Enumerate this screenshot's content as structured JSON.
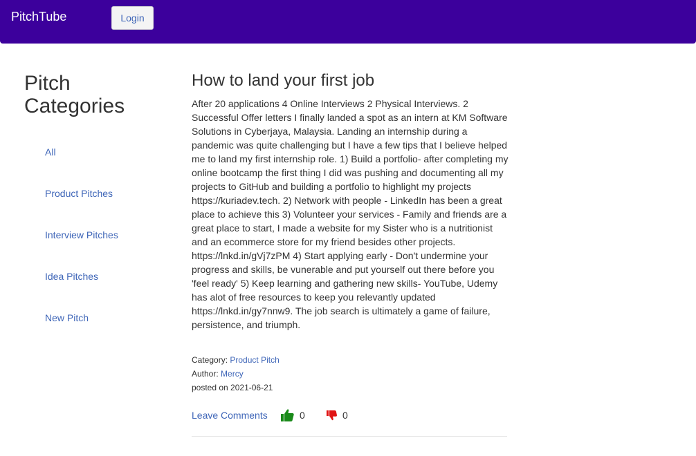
{
  "navbar": {
    "brand": "PitchTube",
    "login_label": "Login",
    "color": "#3c009c"
  },
  "sidebar": {
    "title": "Pitch Categories",
    "items": [
      {
        "label": "All"
      },
      {
        "label": "Product Pitches"
      },
      {
        "label": "Interview Pitches"
      },
      {
        "label": "Idea Pitches"
      },
      {
        "label": "New Pitch"
      }
    ]
  },
  "pitch": {
    "title": "How to land your first job",
    "body": "After 20 applications 4 Online Interviews 2 Physical Interviews. 2 Successful Offer letters I finally landed a spot as an intern at KM Software Solutions in Cyberjaya, Malaysia. Landing an internship during a pandemic was quite challenging but I have a few tips that I believe helped me to land my first internship role. 1) Build a portfolio- after completing my online bootcamp the first thing I did was pushing and documenting all my projects to GitHub and building a portfolio to highlight my projects https://kuriadev.tech. 2) Network with people - LinkedIn has been a great place to achieve this 3) Volunteer your services - Family and friends are a great place to start, I made a website for my Sister who is a nutritionist and an ecommerce store for my friend besides other projects. https://lnkd.in/gVj7zPM 4) Start applying early - Don't undermine your progress and skills, be vunerable and put yourself out there before you 'feel ready' 5) Keep learning and gathering new skills- YouTube, Udemy has alot of free resources to keep you relevantly updated https://lnkd.in/gy7nnw9. The job search is ultimately a game of failure, persistence, and triumph.",
    "category_label": "Category:",
    "category_value": "Product Pitch",
    "author_label": "Author:",
    "author_value": "Mercy",
    "posted_text": "posted on 2021-06-21",
    "comments_label": "Leave Comments",
    "upvotes": "0",
    "downvotes": "0",
    "upvote_icon": "thumbs-up-icon",
    "downvote_icon": "thumbs-down-icon",
    "upvote_color": "#1a8a1a",
    "downvote_color": "#e01414"
  }
}
